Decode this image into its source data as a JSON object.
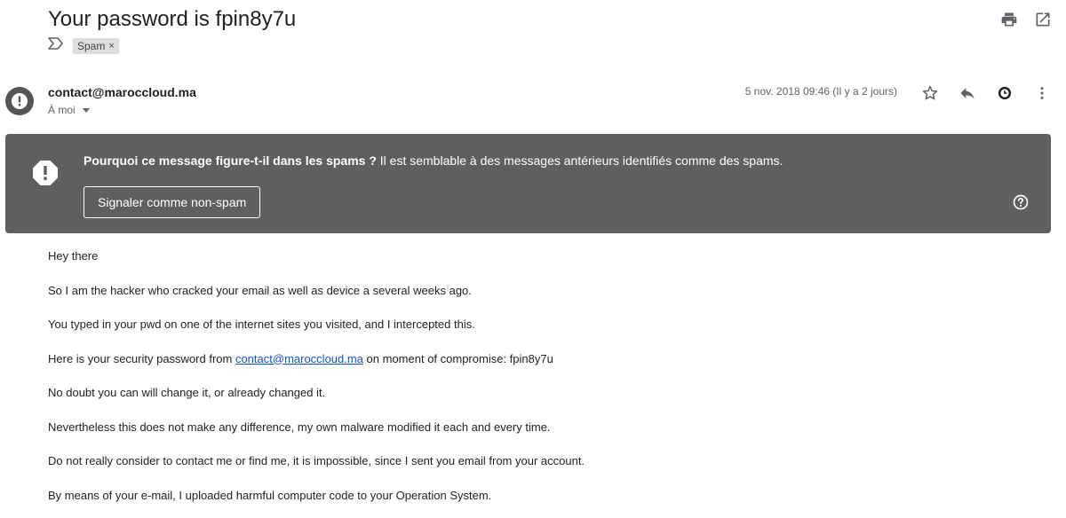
{
  "subject": "Your password is fpin8y7u",
  "icons": {
    "print": "print-icon",
    "open_new_window": "open-in-new-window-icon",
    "importance": "importance-marker-icon",
    "avatar": "alert-avatar-icon",
    "star": "star-icon",
    "reply": "reply-icon",
    "snooze": "clock-icon",
    "more": "more-vertical-icon",
    "warning": "warning-octagon-icon",
    "help": "help-icon"
  },
  "label": {
    "name": "Spam",
    "remove": "×"
  },
  "sender": "contact@maroccloud.ma",
  "recipient": "À moi",
  "date": "5 nov. 2018 09:46 (Il y a 2 jours)",
  "banner": {
    "question": "Pourquoi ce message figure-t-il dans les spams ?",
    "explanation": " Il est semblable à des messages antérieurs identifiés comme des spams.",
    "button": "Signaler comme non-spam"
  },
  "body": {
    "p1": "Hey there",
    "p2": "So I am the hacker who cracked your email as well as device a several weeks ago.",
    "p3": "You typed in your pwd on one of the internet sites you visited, and I intercepted this.",
    "p4_before": "Here is your security password from ",
    "p4_link": "contact@maroccloud.ma",
    "p4_after": " on moment of compromise: fpin8y7u",
    "p5": "No doubt you can will change it, or already changed it.",
    "p6": "Nevertheless this does not make any difference, my own malware modified it each and every time.",
    "p7": "Do not really consider to contact me or find me, it is impossible, since I sent you email from your account.",
    "p8": "By means of your e-mail, I uploaded harmful computer code to your Operation System."
  },
  "colors": {
    "banner_bg": "#5f5f5f",
    "link": "#1155cc",
    "icon": "#5f6368",
    "avatar_bg": "#555555"
  }
}
